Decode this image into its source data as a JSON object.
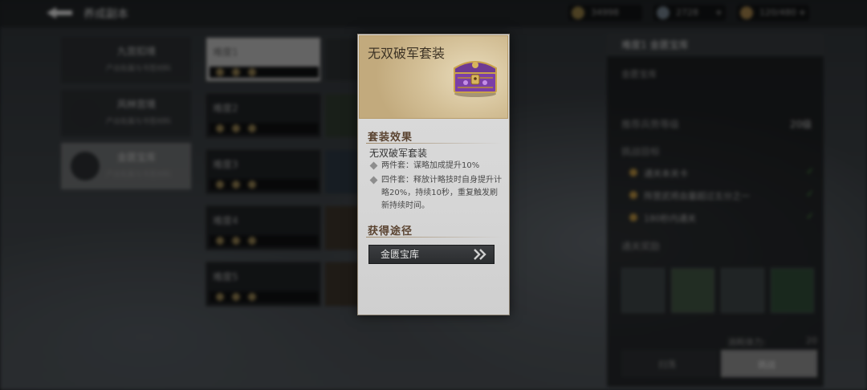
{
  "topbar": {
    "title": "养成副本",
    "gold": "34998",
    "jade": "2728",
    "stamina": "120/480"
  },
  "leftnav": {
    "items": [
      {
        "label": "九宫扣境",
        "sub": "产出佐属与书签材料"
      },
      {
        "label": "风林宫境",
        "sub": "产出佐属与书签材料"
      },
      {
        "label": "金匮宝库",
        "sub": "产出佐属与书签材料"
      }
    ]
  },
  "difficulties": [
    "难度1",
    "难度2",
    "难度3",
    "难度4",
    "难度5"
  ],
  "right_panel": {
    "header": "难度1  金匮宝库",
    "desc": "金匮宝库",
    "recommend_label": "推荐兵势等级",
    "recommend_value": "20级",
    "challenge_title": "挑战目标",
    "goals": [
      "通关本关卡",
      "阵营武将血量超过五分之一",
      "180秒内通关"
    ],
    "rewards_title": "通关奖励",
    "cost_label": "消耗体力:",
    "cost_value": "20",
    "sweep_label": "扫荡",
    "fight_label": "挑战"
  },
  "popup": {
    "title": "无双破军套装",
    "effect_heading": "套装效果",
    "set_name": "无双破军套装",
    "bonus_two": "两件套：谋略加成提升10%",
    "bonus_four": "四件套：释放计略技时自身提升计略20%，持续10秒，重复触发刷新持续时间。",
    "source_heading": "获得途径",
    "source_button": "金匮宝库"
  },
  "colors": {
    "accent_gold": "#c2aa7d",
    "chest_purple": "#7b3fa8",
    "button_dark": "#2b2d2f"
  },
  "icons": [
    "back-icon",
    "treasure-chest-icon",
    "double-chevron-right-icon",
    "diamond-bullet-icon"
  ]
}
